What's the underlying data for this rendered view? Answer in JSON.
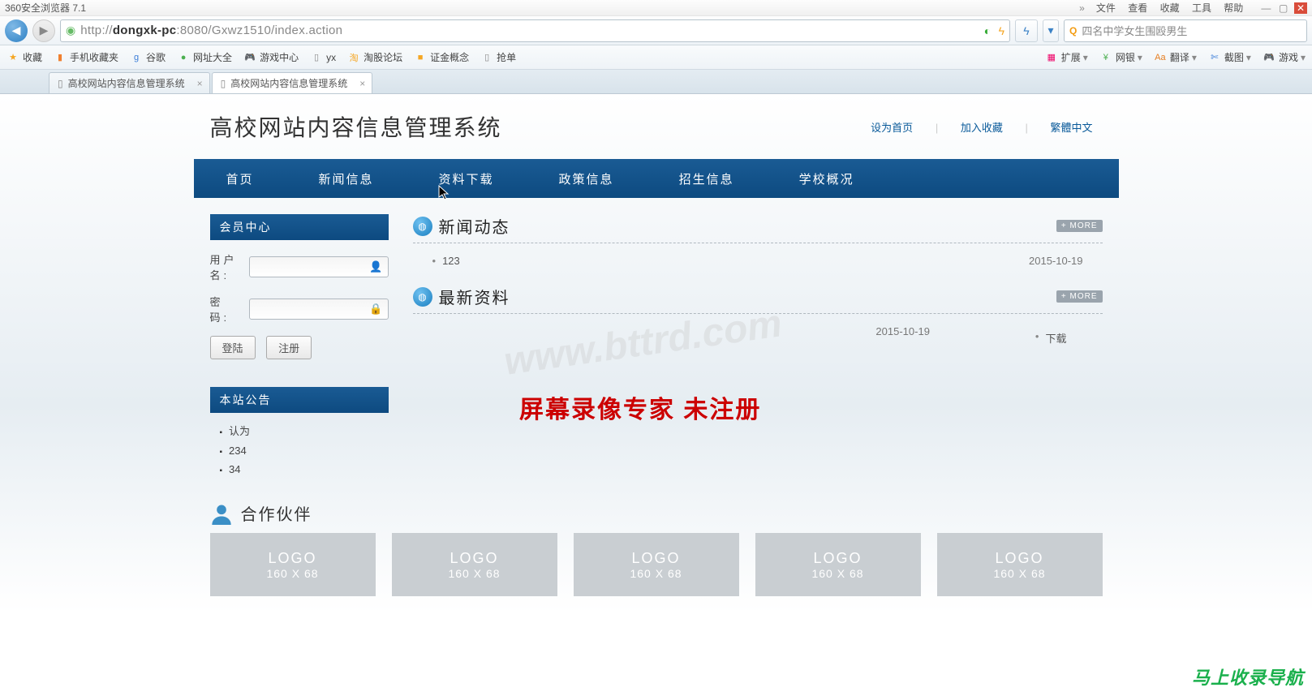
{
  "browser": {
    "title": "360安全浏览器 7.1",
    "menus": [
      "文件",
      "查看",
      "收藏",
      "工具",
      "帮助"
    ],
    "expand": "»",
    "url_plain": "http://dongxk-pc:8080/Gxwz1510/index.action",
    "url_pre": "http://",
    "url_bold": "dongxk-pc",
    "url_post": ":8080/Gxwz1510/index.action",
    "search_placeholder": "四名中学女生围殴男生"
  },
  "bookmarks_left": [
    {
      "icon": "★",
      "color": "#f5a623",
      "label": "收藏"
    },
    {
      "icon": "▮",
      "color": "#f08030",
      "label": "手机收藏夹"
    },
    {
      "icon": "g",
      "color": "#3b7dd8",
      "label": "谷歌"
    },
    {
      "icon": "●",
      "color": "#4caf50",
      "label": "网址大全"
    },
    {
      "icon": "🎮",
      "color": "#d070a0",
      "label": "游戏中心"
    },
    {
      "icon": "▯",
      "color": "#888",
      "label": "yx"
    },
    {
      "icon": "淘",
      "color": "#f5a623",
      "label": "淘股论坛"
    },
    {
      "icon": "■",
      "color": "#f5a623",
      "label": "证金概念"
    },
    {
      "icon": "▯",
      "color": "#888",
      "label": "抢单"
    }
  ],
  "bookmarks_right": [
    {
      "icon": "▦",
      "color": "#e06",
      "label": "扩展",
      "arrow": true
    },
    {
      "icon": "¥",
      "color": "#4caf50",
      "label": "网银",
      "arrow": true
    },
    {
      "icon": "Aa",
      "color": "#e67e22",
      "label": "翻译",
      "arrow": true
    },
    {
      "icon": "✄",
      "color": "#3b7dd8",
      "label": "截图",
      "arrow": true
    },
    {
      "icon": "🎮",
      "color": "#888",
      "label": "游戏",
      "arrow": true
    }
  ],
  "tabs": [
    {
      "label": "高校网站内容信息管理系统",
      "active": false
    },
    {
      "label": "高校网站内容信息管理系统",
      "active": true
    }
  ],
  "site": {
    "title": "高校网站内容信息管理系统",
    "top_links": [
      "设为首页",
      "加入收藏",
      "繁體中文"
    ],
    "nav": [
      "首页",
      "新闻信息",
      "资料下载",
      "政策信息",
      "招生信息",
      "学校概况"
    ]
  },
  "member": {
    "title": "会员中心",
    "user_label": "用户名:",
    "pass_label": "密  码:",
    "login_btn": "登陆",
    "reg_btn": "注册"
  },
  "notice": {
    "title": "本站公告",
    "items": [
      "认为",
      "234",
      "34"
    ]
  },
  "news": {
    "title": "新闻动态",
    "more": "+ MORE",
    "items": [
      {
        "text": "123",
        "date": "2015-10-19"
      }
    ]
  },
  "resources": {
    "title": "最新资料",
    "more": "+ MORE",
    "date": "2015-10-19",
    "sub": "下载"
  },
  "partners": {
    "title": "合作伙伴",
    "logo_text": "LOGO",
    "logo_size": "160 X 68",
    "count": 5
  },
  "watermarks": {
    "url": "www.bttrd.com",
    "screen_rec": "屏幕录像专家  未注册",
    "footer": "马上收录导航"
  }
}
